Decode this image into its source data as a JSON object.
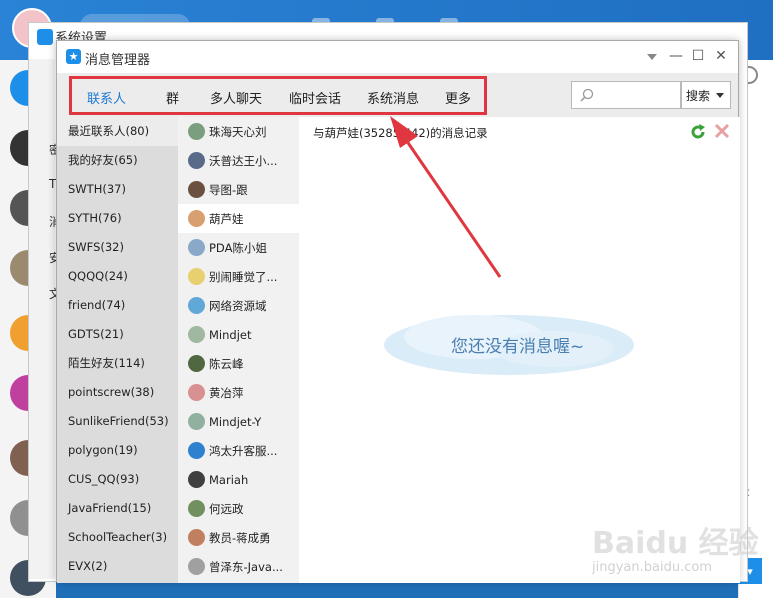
{
  "background": {
    "settings_title": "系统设置",
    "settings_side_items": [
      "密",
      "T",
      "消",
      "安",
      "文"
    ],
    "right_text": "录",
    "right_btn": "▾"
  },
  "window": {
    "title": "消息管理器"
  },
  "tabs": [
    {
      "label": "联系人",
      "active": true
    },
    {
      "label": "群",
      "active": false
    },
    {
      "label": "多人聊天",
      "active": false
    },
    {
      "label": "临时会话",
      "active": false
    },
    {
      "label": "系统消息",
      "active": false
    },
    {
      "label": "更多",
      "active": false
    }
  ],
  "search": {
    "placeholder": "",
    "button_label": "搜索"
  },
  "groups": [
    "最近联系人(80)",
    "我的好友(65)",
    "SWTH(37)",
    "SYTH(76)",
    "SWFS(32)",
    "QQQQ(24)",
    "friend(74)",
    "GDTS(21)",
    "陌生好友(114)",
    "pointscrew(38)",
    "SunlikeFriend(53)",
    "polygon(19)",
    "CUS_QQ(93)",
    "JavaFriend(15)",
    "SchoolTeacher(3)",
    "EVX(2)"
  ],
  "contacts": [
    {
      "name": "珠海天心刘",
      "color": "#7a9e7e"
    },
    {
      "name": "沃普达王小...",
      "color": "#5a6a8a"
    },
    {
      "name": "导图-跟",
      "color": "#6b5040"
    },
    {
      "name": "葫芦娃",
      "color": "#d8a070"
    },
    {
      "name": "PDA陈小姐",
      "color": "#8aa8c8"
    },
    {
      "name": "别闹睡觉了...",
      "color": "#e8d070"
    },
    {
      "name": "网络资源域",
      "color": "#60a8d8"
    },
    {
      "name": "Mindjet",
      "color": "#a0b8a0"
    },
    {
      "name": "陈云峰",
      "color": "#506840"
    },
    {
      "name": "黄冶萍",
      "color": "#d89090"
    },
    {
      "name": "Mindjet-Y",
      "color": "#90b0a0"
    },
    {
      "name": "鸿太升客服...",
      "color": "#3080d0"
    },
    {
      "name": "Mariah",
      "color": "#404040"
    },
    {
      "name": "何远政",
      "color": "#709060"
    },
    {
      "name": "教员-蒋成勇",
      "color": "#c08060"
    },
    {
      "name": "曾泽东-Java...",
      "color": "#a0a0a0"
    }
  ],
  "selected_contact_index": 3,
  "messages": {
    "header": "与葫芦娃(35285  542)的消息记录",
    "empty_text": "您还没有消息喔~"
  },
  "watermark": {
    "main": "Baidu 经验",
    "sub": "jingyan.baidu.com"
  },
  "colors": {
    "accent": "#1e7ad6",
    "highlight_border": "#e0363f",
    "arrow": "#e0363f"
  }
}
